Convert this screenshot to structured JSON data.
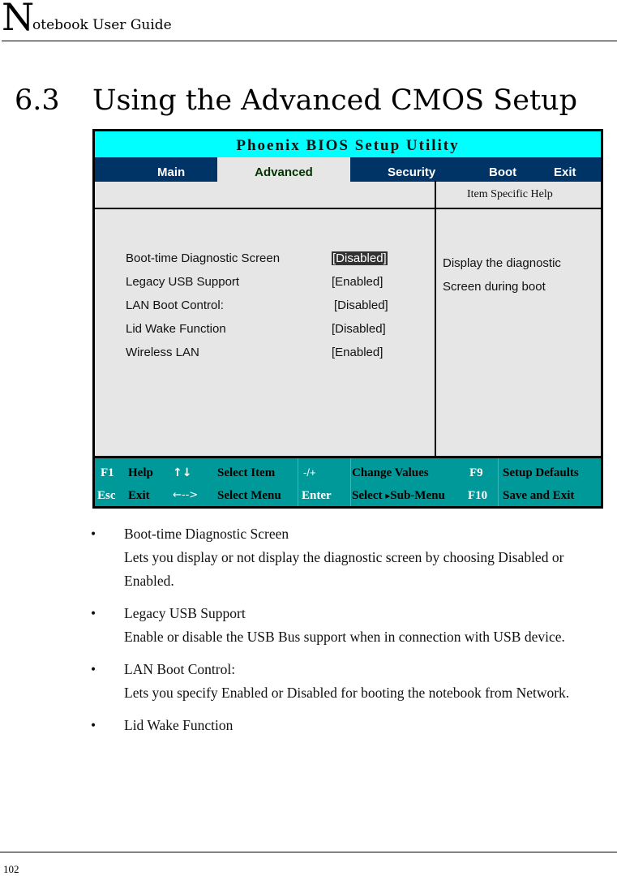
{
  "header": {
    "initial": "N",
    "rest": "otebook User Guide"
  },
  "section": {
    "number": "6.3",
    "title": "Using the Advanced CMOS Setup"
  },
  "bios": {
    "title": "Phoenix BIOS Setup Utility",
    "menu": [
      "Main",
      "Advanced",
      "Security",
      "Boot",
      "Exit"
    ],
    "active_menu": "Advanced",
    "help_header": "Item Specific Help",
    "settings": [
      {
        "name": "Boot-time Diagnostic Screen",
        "value": "[Disabled]",
        "selected": true
      },
      {
        "name": "Legacy USB Support",
        "value": "[Enabled]"
      },
      {
        "name": "LAN Boot Control:",
        "value": "[Disabled]"
      },
      {
        "name": "Lid Wake Function",
        "value": "[Disabled]"
      },
      {
        "name": "Wireless LAN",
        "value": "[Enabled]"
      }
    ],
    "help_lines": [
      "Display the diagnostic",
      "Screen during boot"
    ],
    "keybar": {
      "row1": {
        "k1": "F1",
        "d1": "Help",
        "k2": "↑↓",
        "d2": "Select Item",
        "k3": "-/+",
        "d3": "Change Values",
        "k4": "F9",
        "d4": "Setup Defaults"
      },
      "row2": {
        "k1": "Esc",
        "d1": "Exit",
        "k2": "←-->",
        "d2": "Select Menu",
        "k3": "Enter",
        "d3a": "Select",
        "arrow": "▸",
        "d3b": "Sub-Menu",
        "k4": "F10",
        "d4": "Save and Exit"
      }
    }
  },
  "bullets": [
    {
      "title": "Boot-time Diagnostic Screen",
      "text": "Lets you display or not display the diagnostic screen by choosing Disabled or Enabled."
    },
    {
      "title": "Legacy USB Support",
      "text": "Enable or disable the USB Bus support when in connection with USB device."
    },
    {
      "title": "LAN Boot Control:",
      "text": "Lets you specify Enabled or Disabled for booting the notebook from Network."
    },
    {
      "title": "Lid Wake Function",
      "text": ""
    }
  ],
  "bullet_glyph": "•",
  "footer": {
    "page_number": "102"
  }
}
